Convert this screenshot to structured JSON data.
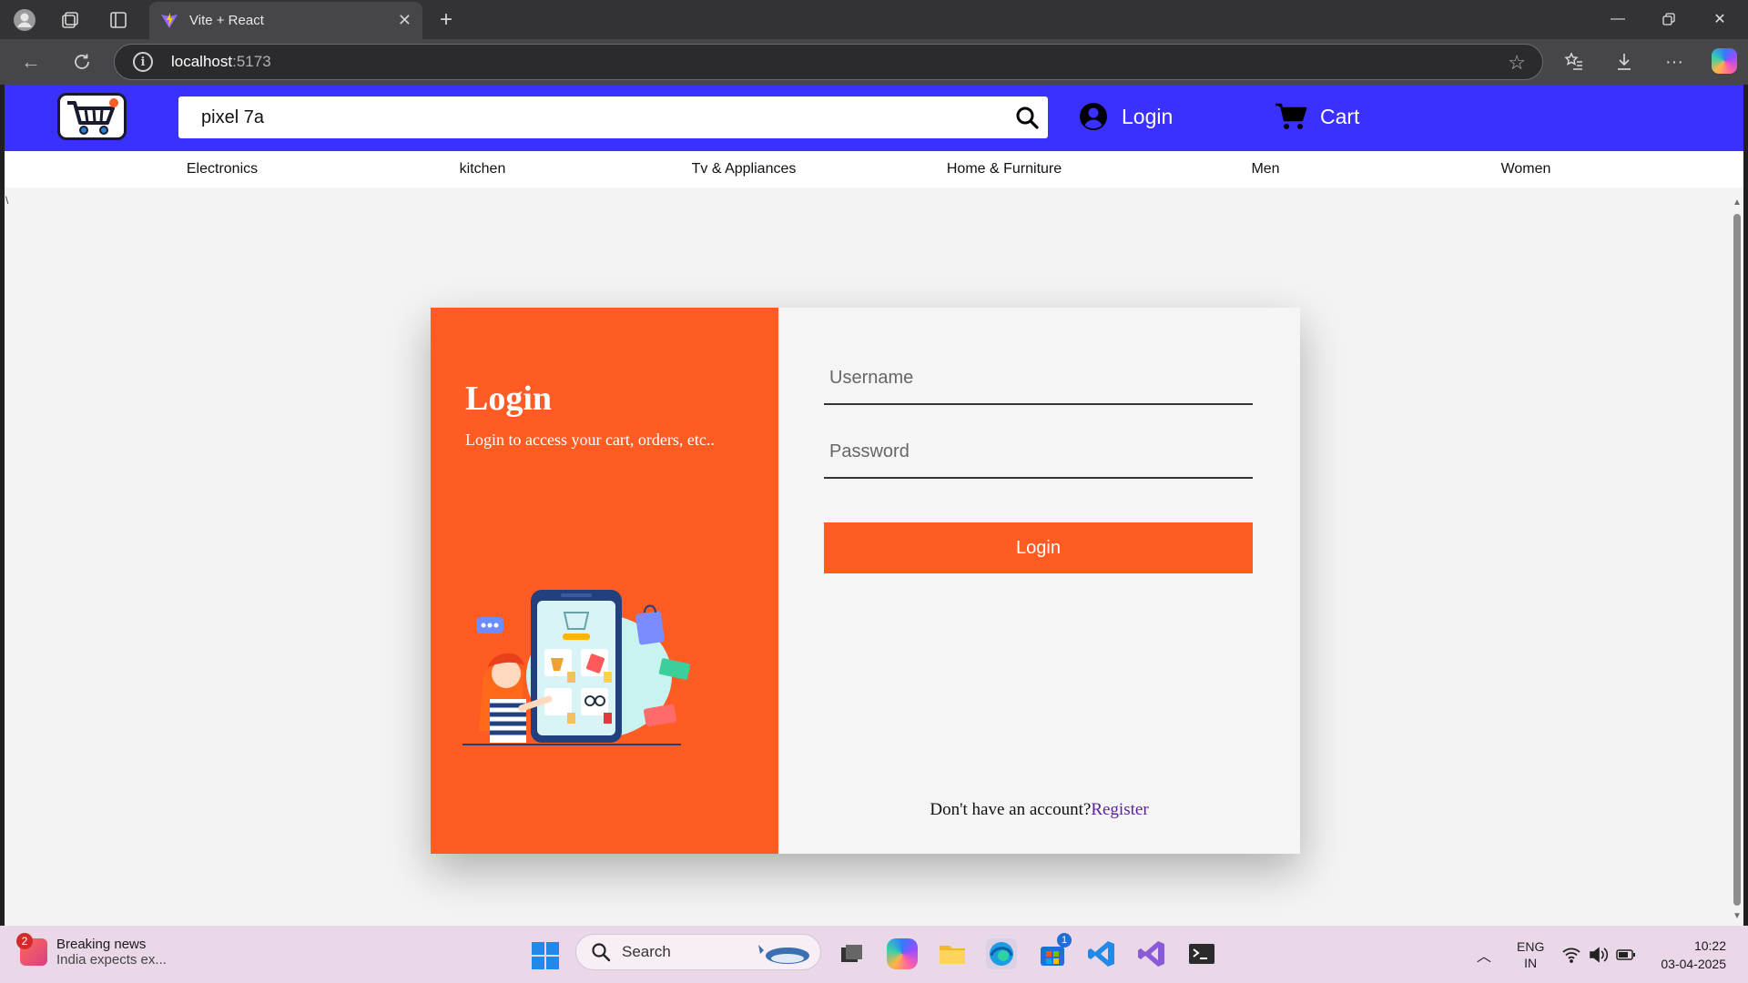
{
  "browser": {
    "tab_title": "Vite + React",
    "url_host": "localhost",
    "url_port": ":5173"
  },
  "navbar": {
    "search_value": "pixel 7a",
    "login_label": "Login",
    "cart_label": "Cart"
  },
  "categories": [
    "Electronics",
    "kitchen",
    "Tv & Appliances",
    "Home & Furniture",
    "Men",
    "Women"
  ],
  "stray_char": "\\",
  "login_card": {
    "heading": "Login",
    "subtext": "Login to access your cart, orders, etc..",
    "username_placeholder": "Username",
    "password_placeholder": "Password",
    "submit_label": "Login",
    "register_prompt": "Don't have an account?",
    "register_link": "Register"
  },
  "taskbar": {
    "news_badge": "2",
    "news_title": "Breaking news",
    "news_sub": "India expects ex...",
    "search_label": "Search",
    "store_badge": "1",
    "lang_top": "ENG",
    "lang_bottom": "IN",
    "time": "10:22",
    "date": "03-04-2025"
  },
  "colors": {
    "nav_blue": "#3a30ff",
    "accent_orange": "#ff5c23",
    "register_link": "#5a1fa0"
  }
}
